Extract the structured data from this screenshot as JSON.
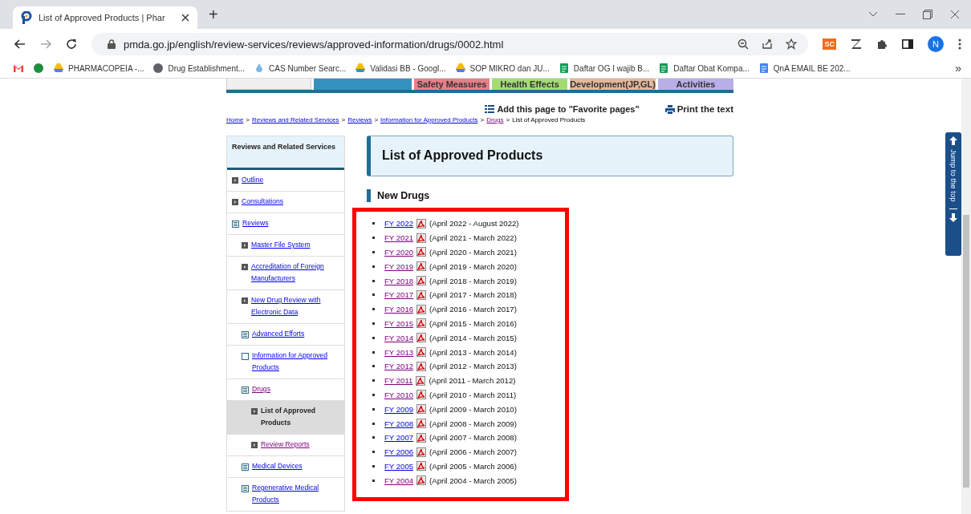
{
  "browser": {
    "tab_title": "List of Approved Products | Phar",
    "new_tab": "+",
    "address": "pmda.go.jp/english/review-services/reviews/approved-information/drugs/0002.html",
    "profile": "N",
    "extension_badge": "SC",
    "bookmarks": [
      {
        "kind": "gmail"
      },
      {
        "kind": "circle-logo"
      },
      {
        "label": "PHARMACOPEIA -...",
        "kind": "drive"
      },
      {
        "label": "Drug Establishment...",
        "kind": "globe"
      },
      {
        "label": "CAS Number Searc...",
        "kind": "drop"
      },
      {
        "label": "Validasi BB - Googl...",
        "kind": "drive"
      },
      {
        "label": "SOP MIKRO dan JU...",
        "kind": "drive"
      },
      {
        "label": "Daftar OG I wajib B...",
        "kind": "sheet"
      },
      {
        "label": "Daftar Obat Kompa...",
        "kind": "sheet"
      },
      {
        "label": "QnA EMAIL BE 202...",
        "kind": "doc"
      }
    ],
    "more": "»"
  },
  "nav_tabs": [
    {
      "color": "#f0f0f0"
    },
    {
      "color": "#3591bd"
    },
    {
      "label": "Safety Measures",
      "color": "#e5808a"
    },
    {
      "label": "Health Effects",
      "color": "#a4dc74"
    },
    {
      "label": "Development(JP,GL)",
      "color": "#e2b79a"
    },
    {
      "label": "Activities",
      "color": "#b9afe8"
    }
  ],
  "favorite": "Add this page to \"Favorite pages\"",
  "print": "Print the text",
  "breadcrumb_separator": ">",
  "breadcrumb": [
    {
      "label": "Home",
      "kind": "link",
      "visited": false
    },
    {
      "label": "Reviews and Related Services",
      "kind": "link",
      "visited": false
    },
    {
      "label": "Reviews",
      "kind": "link",
      "visited": false
    },
    {
      "label": "Information for Approved Products",
      "kind": "link",
      "visited": false
    },
    {
      "label": "Drugs",
      "kind": "link",
      "visited": true
    },
    {
      "label": "List of Approved Products",
      "kind": "current"
    }
  ],
  "sidebar": {
    "title": "Reviews and Related Services",
    "items": [
      {
        "label": "Outline",
        "kind": "leaf",
        "visited": false,
        "selected": false
      },
      {
        "label": "Consultations",
        "kind": "leaf",
        "visited": false,
        "selected": false
      },
      {
        "label": "Reviews",
        "kind": "folder",
        "visited": false,
        "selected": false,
        "children": [
          {
            "label": "Master File System",
            "kind": "leaf",
            "visited": false,
            "selected": false
          },
          {
            "label": "Accreditation of Foreign Manufacturers",
            "kind": "leaf",
            "visited": false,
            "selected": false
          },
          {
            "label": "New Drug Review with Electronic Data",
            "kind": "leaf",
            "visited": false,
            "selected": false
          },
          {
            "label": "Advanced Efforts",
            "kind": "folder",
            "visited": false,
            "selected": false
          },
          {
            "label": "Information for Approved Products",
            "kind": "page",
            "visited": false,
            "selected": false
          },
          {
            "label": "Drugs",
            "kind": "folder",
            "visited": true,
            "selected": false,
            "children": [
              {
                "label": "List of Approved Products",
                "kind": "leaf",
                "selected": true
              },
              {
                "label": "Review Reports",
                "kind": "leaf",
                "visited": true,
                "selected": false
              }
            ]
          },
          {
            "label": "Medical Devices",
            "kind": "folder",
            "visited": false,
            "selected": false
          },
          {
            "label": "Regenerative Medical Products",
            "kind": "folder",
            "visited": false,
            "selected": false
          }
        ]
      }
    ]
  },
  "title": "List of Approved Products",
  "section": "New Drugs",
  "reports": [
    {
      "year": "FY 2022",
      "period": "(April 2022 - August 2022)",
      "visited": false
    },
    {
      "year": "FY 2021",
      "period": "(April 2021 - March 2022)",
      "visited": true
    },
    {
      "year": "FY 2020",
      "period": "(April 2020 - March 2021)",
      "visited": true
    },
    {
      "year": "FY 2019",
      "period": "(April 2019 - March 2020)",
      "visited": true
    },
    {
      "year": "FY 2018",
      "period": "(April 2018 - March 2019)",
      "visited": true
    },
    {
      "year": "FY 2017",
      "period": "(April 2017 - March 2018)",
      "visited": true
    },
    {
      "year": "FY 2016",
      "period": "(April 2016 - March 2017)",
      "visited": true
    },
    {
      "year": "FY 2015",
      "period": "(April 2015 - March 2016)",
      "visited": true
    },
    {
      "year": "FY 2014",
      "period": "(April 2014 - March 2015)",
      "visited": true
    },
    {
      "year": "FY 2013",
      "period": "(April 2013 - March 2014)",
      "visited": true
    },
    {
      "year": "FY 2012",
      "period": "(April 2012 - March 2013)",
      "visited": true
    },
    {
      "year": "FY 2011",
      "period": "(April 2011 - March 2012)",
      "visited": true
    },
    {
      "year": "FY 2010",
      "period": "(April 2010 - March 2011)",
      "visited": true
    },
    {
      "year": "FY 2009",
      "period": "(April 2009 - March 2010)",
      "visited": false
    },
    {
      "year": "FY 2008",
      "period": "(April 2008 - March 2009)",
      "visited": false
    },
    {
      "year": "FY 2007",
      "period": "(April 2007 - March 2008)",
      "visited": false
    },
    {
      "year": "FY 2006",
      "period": "(April 2006 - March 2007)",
      "visited": false
    },
    {
      "year": "FY 2005",
      "period": "(April 2005 - March 2006)",
      "visited": false
    },
    {
      "year": "FY 2004",
      "period": "(April 2004 - March 2005)",
      "visited": true
    }
  ],
  "jump": {
    "label": "Jump to the top"
  }
}
